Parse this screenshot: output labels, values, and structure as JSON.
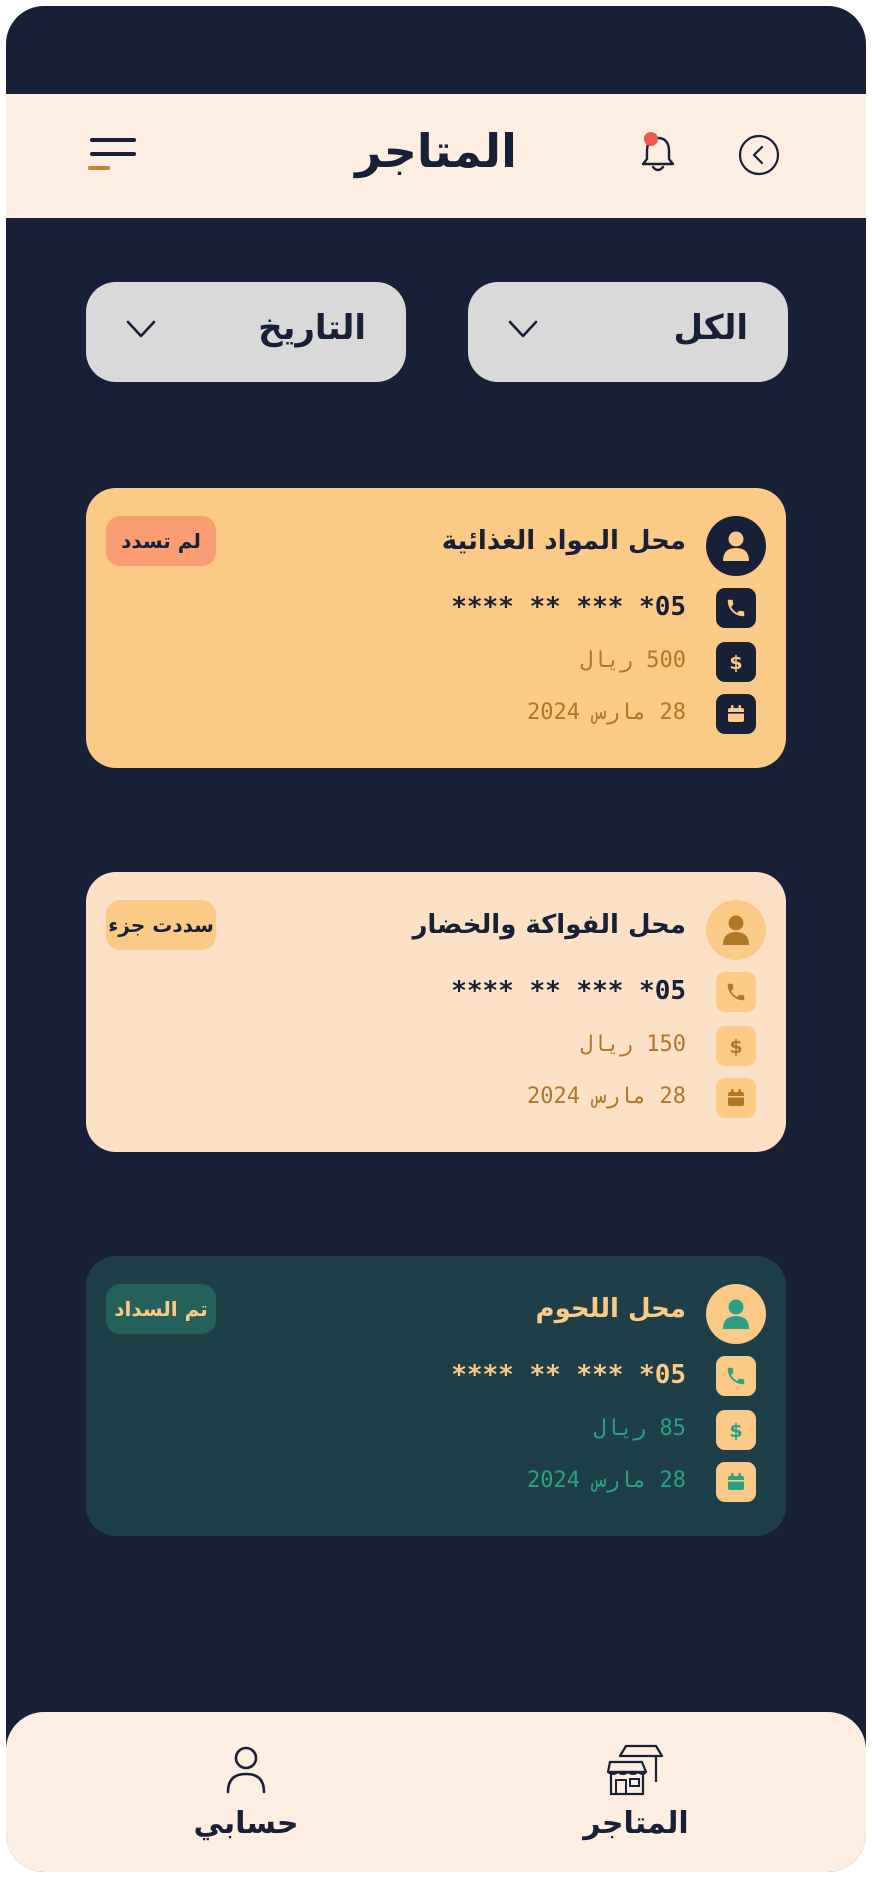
{
  "header": {
    "title": "المتاجر"
  },
  "filters": {
    "status_label": "الكل",
    "date_label": "التاريخ"
  },
  "stores": [
    {
      "name": "محل المواد الغذائية",
      "phone": "05* *** ** ****",
      "amount": "500 ريال",
      "date": "28 مارس 2024",
      "status": "لم تسدد"
    },
    {
      "name": "محل الفواكة والخضار",
      "phone": "05* *** ** ****",
      "amount": "150 ريال",
      "date": "28 مارس 2024",
      "status": "سددت جزء"
    },
    {
      "name": "محل اللحوم",
      "phone": "05* *** ** ****",
      "amount": "85 ريال",
      "date": "28 مارس 2024",
      "status": "تم السداد"
    }
  ],
  "bottom_nav": {
    "account_label": "حسابي",
    "stores_label": "المتاجر"
  },
  "colors": {
    "background": "#172036",
    "header_bg": "#FDEEE1",
    "unpaid_card": "#FBCA86",
    "partial_card": "#FDE1C7",
    "paid_card": "#1E3F48",
    "unpaid_badge": "#FB9D72",
    "paid_accent": "#2BA084",
    "notification_dot": "#F0584A"
  },
  "icons": [
    "menu-icon",
    "bell-icon",
    "back-chevron-icon",
    "chevron-down-icon",
    "user-icon",
    "phone-icon",
    "dollar-icon",
    "calendar-icon",
    "shop-icon"
  ]
}
